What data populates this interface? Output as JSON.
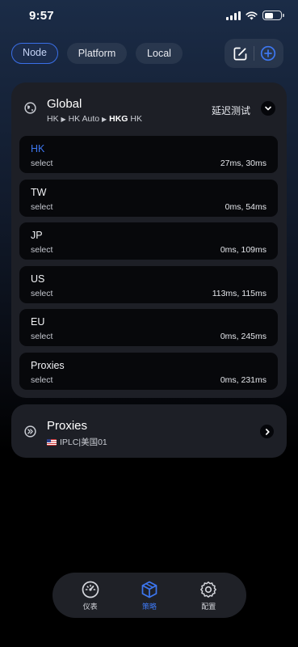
{
  "status_bar": {
    "time": "9:57",
    "battery_level": 0.55
  },
  "tabs": [
    {
      "label": "Node",
      "active": true
    },
    {
      "label": "Platform",
      "active": false
    },
    {
      "label": "Local",
      "active": false
    }
  ],
  "top_actions": {
    "edit_icon": "edit-icon",
    "add_icon": "add-icon"
  },
  "group": {
    "title": "Global",
    "path": {
      "part1": "HK",
      "sep1": "▶",
      "part2": "HK Auto",
      "sep2": "▶",
      "part3": "HKG",
      "part4": "HK"
    },
    "latency_test_label": "延迟测试",
    "nodes": [
      {
        "name": "HK",
        "type": "select",
        "latency": "27ms, 30ms",
        "selected": true
      },
      {
        "name": "TW",
        "type": "select",
        "latency": "0ms, 54ms",
        "selected": false
      },
      {
        "name": "JP",
        "type": "select",
        "latency": "0ms, 109ms",
        "selected": false
      },
      {
        "name": "US",
        "type": "select",
        "latency": "113ms, 115ms",
        "selected": false
      },
      {
        "name": "EU",
        "type": "select",
        "latency": "0ms, 245ms",
        "selected": false
      },
      {
        "name": "Proxies",
        "type": "select",
        "latency": "0ms, 231ms",
        "selected": false
      }
    ]
  },
  "proxies_group": {
    "title": "Proxies",
    "subtitle": "IPLC|美国01",
    "flag": "us-flag"
  },
  "bottom_nav": [
    {
      "label": "仪表",
      "icon": "dashboard-icon",
      "active": false
    },
    {
      "label": "策略",
      "icon": "cube-icon",
      "active": true
    },
    {
      "label": "配置",
      "icon": "settings-icon",
      "active": false
    }
  ],
  "colors": {
    "accent": "#3d77f0",
    "card": "#1d1f26",
    "node_bg": "#07080b"
  }
}
